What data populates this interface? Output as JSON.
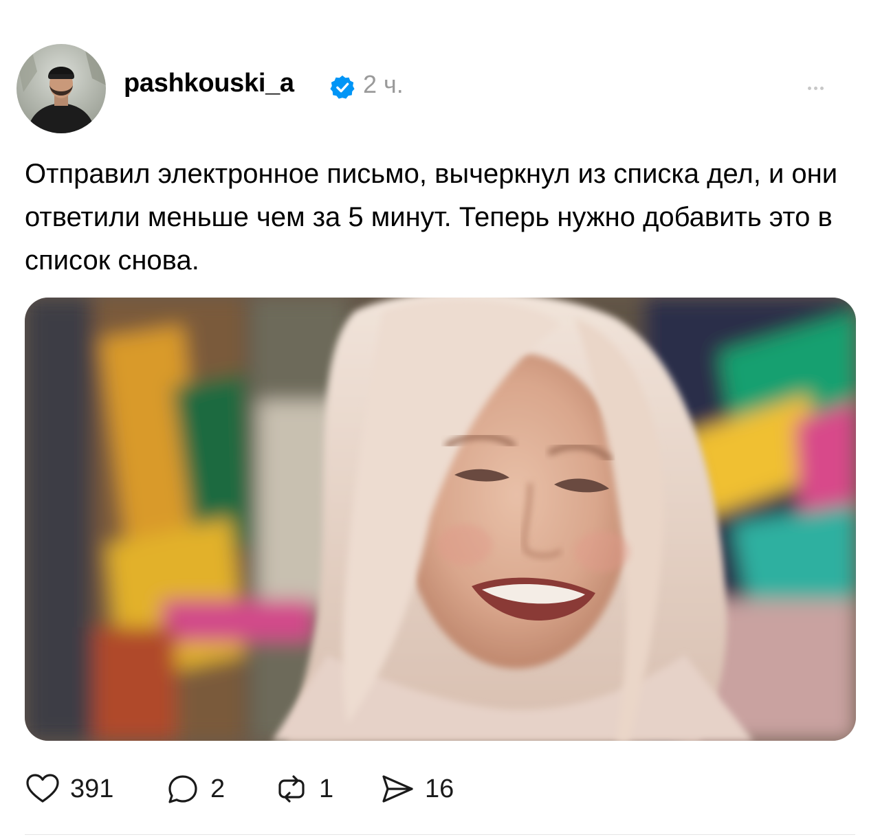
{
  "post": {
    "author": {
      "username": "pashkouski_a",
      "verified": true,
      "time_ago": "2 ч."
    },
    "text": "Отправил электронное письмо, вычеркнул из списка дел, и они ответили меньше чем за 5 минут. Теперь нужно добавить это в список снова.",
    "media": {
      "type": "photo"
    },
    "actions": {
      "likes": "391",
      "comments": "2",
      "reposts": "1",
      "shares": "16"
    }
  },
  "colors": {
    "verified_badge": "#0095f6",
    "timestamp": "#9a9a9a",
    "icon_stroke": "#1a1a1a"
  }
}
